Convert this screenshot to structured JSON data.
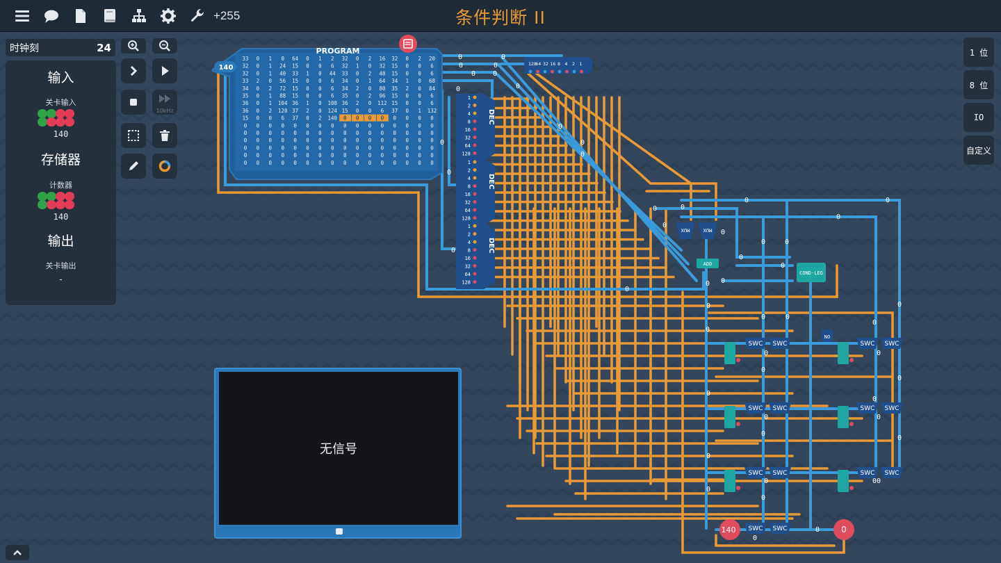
{
  "topbar": {
    "icons": [
      "menu-icon",
      "chat-icon",
      "document-icon",
      "book-icon",
      "hierarchy-icon",
      "gear-icon",
      "wrench-icon"
    ],
    "counter": "+255"
  },
  "level": {
    "title": "条件判断 II"
  },
  "clock": {
    "label": "时钟刻",
    "value": "24"
  },
  "panel": {
    "input_title": "输入",
    "input_sub": "关卡输入",
    "input_value": "140",
    "memory_title": "存储器",
    "memory_sub": "计数器",
    "memory_value": "140",
    "output_title": "输出",
    "output_sub": "关卡输出",
    "output_value": "-"
  },
  "tools": {
    "speed_label": "10kHz"
  },
  "right_buttons": [
    "1 位",
    "8 位",
    "IO",
    "自定义"
  ],
  "program": {
    "title": "PROGRAM",
    "address": "140",
    "rows": [
      [
        "33",
        "0",
        "1",
        "0",
        "64",
        "0",
        "1",
        "2",
        "32",
        "0",
        "2",
        "16",
        "32",
        "0",
        "2",
        "20"
      ],
      [
        "32",
        "0",
        "1",
        "24",
        "15",
        "0",
        "0",
        "6",
        "32",
        "1",
        "0",
        "32",
        "15",
        "0",
        "0",
        "6"
      ],
      [
        "32",
        "0",
        "1",
        "40",
        "33",
        "1",
        "0",
        "44",
        "33",
        "0",
        "2",
        "48",
        "15",
        "0",
        "0",
        "6"
      ],
      [
        "33",
        "2",
        "0",
        "56",
        "15",
        "0",
        "0",
        "6",
        "34",
        "0",
        "1",
        "64",
        "34",
        "1",
        "0",
        "68"
      ],
      [
        "34",
        "0",
        "2",
        "72",
        "15",
        "0",
        "0",
        "6",
        "34",
        "2",
        "0",
        "80",
        "35",
        "2",
        "0",
        "84"
      ],
      [
        "35",
        "0",
        "1",
        "88",
        "15",
        "0",
        "0",
        "6",
        "35",
        "0",
        "2",
        "96",
        "15",
        "0",
        "0",
        "6"
      ],
      [
        "36",
        "0",
        "1",
        "104",
        "36",
        "1",
        "0",
        "108",
        "36",
        "2",
        "0",
        "112",
        "15",
        "0",
        "0",
        "6"
      ],
      [
        "36",
        "0",
        "2",
        "120",
        "37",
        "2",
        "0",
        "124",
        "15",
        "0",
        "0",
        "6",
        "37",
        "0",
        "1",
        "132"
      ],
      [
        "15",
        "0",
        "0",
        "6",
        "37",
        "0",
        "2",
        "140",
        "0",
        "0",
        "0",
        "0",
        "0",
        "0",
        "0",
        "0"
      ],
      [
        "0",
        "0",
        "0",
        "0",
        "0",
        "0",
        "0",
        "0",
        "0",
        "0",
        "0",
        "0",
        "0",
        "0",
        "0",
        "0"
      ],
      [
        "0",
        "0",
        "0",
        "0",
        "0",
        "0",
        "0",
        "0",
        "0",
        "0",
        "0",
        "0",
        "0",
        "0",
        "0",
        "0"
      ],
      [
        "0",
        "0",
        "0",
        "0",
        "0",
        "0",
        "0",
        "0",
        "0",
        "0",
        "0",
        "0",
        "0",
        "0",
        "0",
        "0"
      ],
      [
        "0",
        "0",
        "0",
        "0",
        "0",
        "0",
        "0",
        "0",
        "0",
        "0",
        "0",
        "0",
        "0",
        "0",
        "0",
        "0"
      ],
      [
        "0",
        "0",
        "0",
        "0",
        "0",
        "0",
        "0",
        "0",
        "0",
        "0",
        "0",
        "0",
        "0",
        "0",
        "0",
        "0"
      ],
      [
        "0",
        "0",
        "0",
        "0",
        "0",
        "0",
        "0",
        "0",
        "0",
        "0",
        "0",
        "0",
        "0",
        "0",
        "0",
        "0"
      ]
    ],
    "highlight": {
      "row": 8,
      "cols": [
        8,
        9,
        10,
        11
      ]
    }
  },
  "components": {
    "dec_label": "DEC",
    "dec_bits": [
      "1",
      "2",
      "4",
      "8",
      "16",
      "32",
      "64",
      "128"
    ],
    "splitter_bits": [
      "128",
      "64",
      "32",
      "16",
      "8",
      "4",
      "2",
      "1"
    ],
    "mux_label": "MUX",
    "swc_label": "SWC",
    "cond_label": "COND-LEG",
    "inverter_label": "NO",
    "add_label": "ADD",
    "counter_value": "140",
    "output_value": "0"
  },
  "screen": {
    "text": "无信号"
  },
  "colors": {
    "wire_orange": "#e79a36",
    "wire_blue": "#3b9ad9",
    "background": "#33465c",
    "panel": "#25303d",
    "component_teal": "#1fa6a0",
    "component_navy": "#1f4f8c"
  }
}
